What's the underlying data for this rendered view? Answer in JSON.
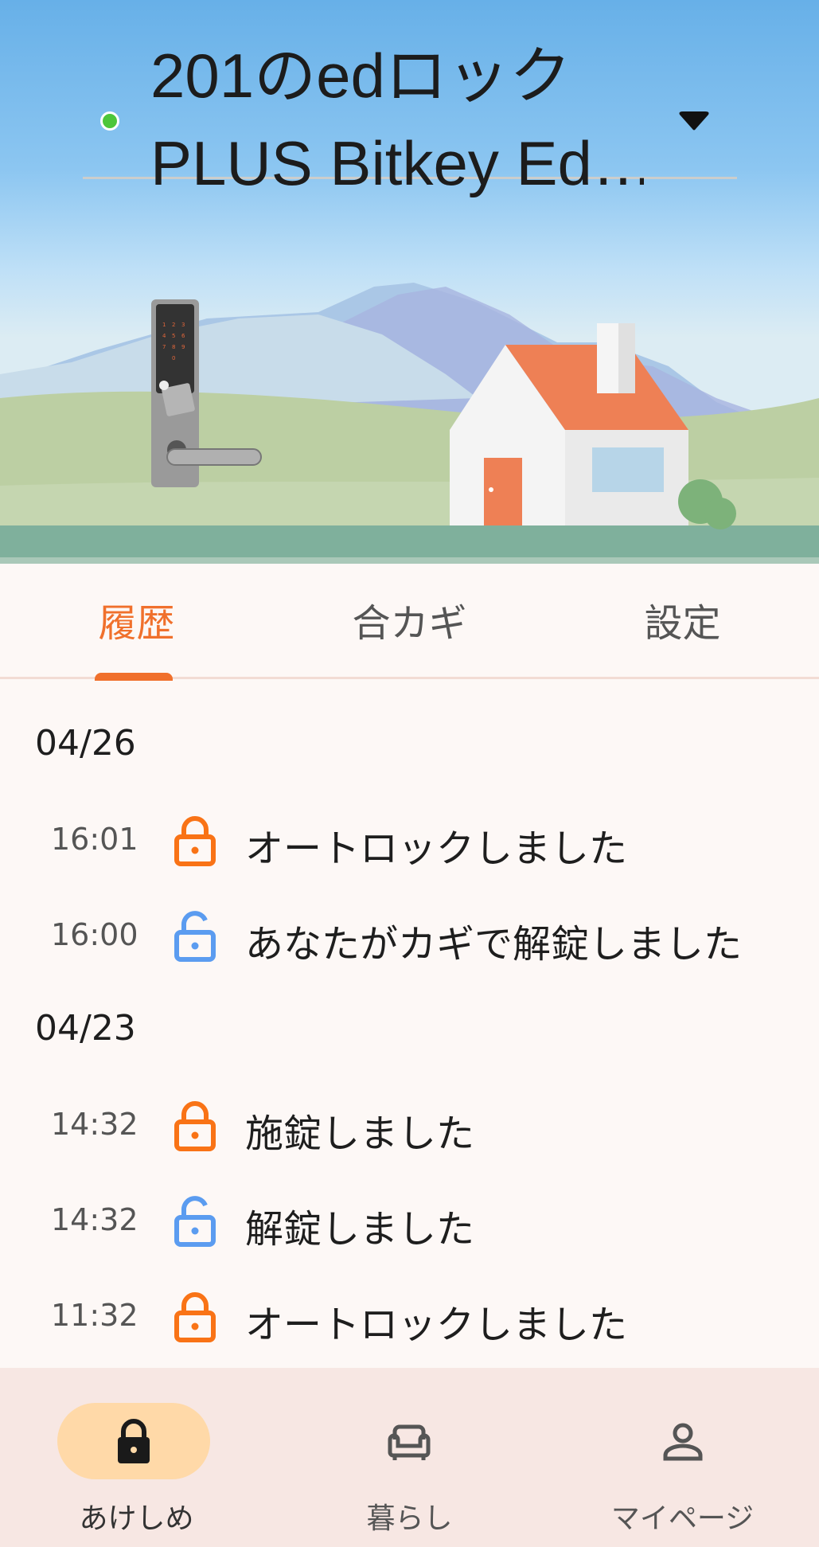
{
  "header": {
    "device_name_line1": "201のedロック",
    "device_name_line2": "PLUS Bitkey Ed…",
    "status_color": "#4cc63a",
    "dropdown_icon": "caret-down-icon"
  },
  "keypad_digits": [
    "1",
    "2",
    "3",
    "4",
    "5",
    "6",
    "7",
    "8",
    "9",
    "0"
  ],
  "tabs": [
    {
      "label": "履歴",
      "active": true
    },
    {
      "label": "合カギ",
      "active": false
    },
    {
      "label": "設定",
      "active": false
    }
  ],
  "history": {
    "groups": [
      {
        "date": "04/26",
        "entries": [
          {
            "time": "16:01",
            "icon": "lock-closed-icon",
            "color": "#f97316",
            "message": "オートロックしました"
          },
          {
            "time": "16:00",
            "icon": "lock-open-icon",
            "color": "#5b9cf0",
            "message": "あなたがカギで解錠しました"
          }
        ]
      },
      {
        "date": "04/23",
        "entries": [
          {
            "time": "14:32",
            "icon": "lock-closed-icon",
            "color": "#f97316",
            "message": "施錠しました"
          },
          {
            "time": "14:32",
            "icon": "lock-open-icon",
            "color": "#5b9cf0",
            "message": "解錠しました"
          },
          {
            "time": "11:32",
            "icon": "lock-closed-icon",
            "color": "#f97316",
            "message": "オートロックしました"
          }
        ]
      }
    ]
  },
  "bottom_nav": [
    {
      "label": "あけしめ",
      "icon": "lock-icon",
      "active": true
    },
    {
      "label": "暮らし",
      "icon": "sofa-icon",
      "active": false
    },
    {
      "label": "マイページ",
      "icon": "person-icon",
      "active": false
    }
  ],
  "colors": {
    "accent": "#f0702c",
    "locked": "#f97316",
    "unlocked": "#5b9cf0",
    "nav_active_pill": "#ffd9a8"
  }
}
